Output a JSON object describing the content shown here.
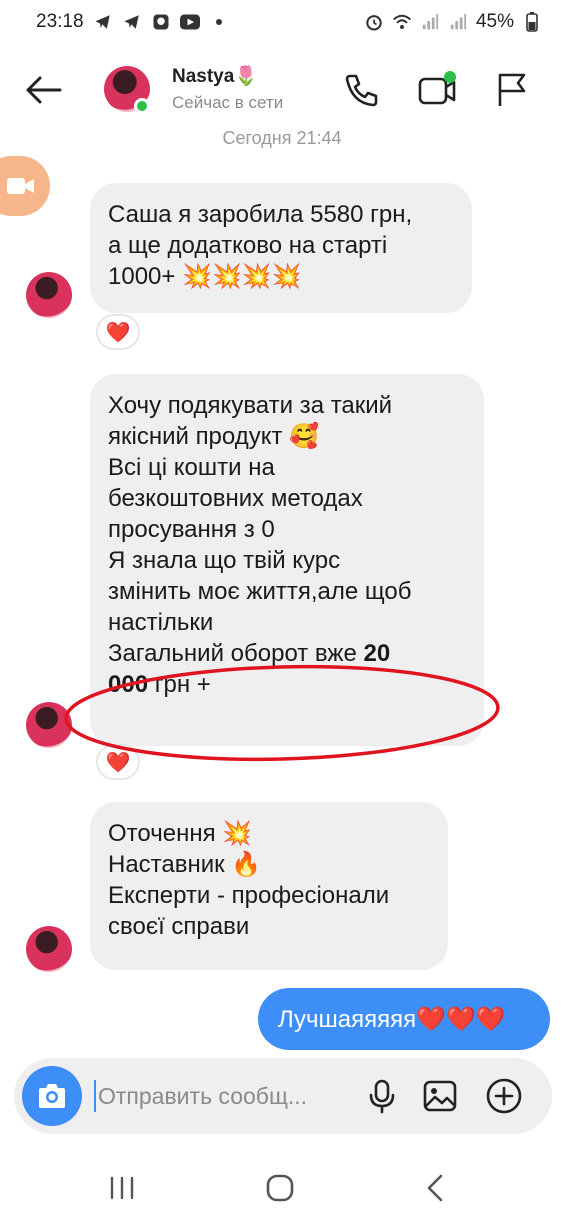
{
  "status_bar": {
    "time": "23:18",
    "battery": "45%",
    "left_icons": [
      "telegram-icon",
      "telegram-icon",
      "viber-icon",
      "youtube-icon",
      "dot-icon"
    ],
    "right_icons": [
      "alarm-icon",
      "wifi-icon",
      "signal-icon",
      "signal-icon",
      "battery-icon"
    ]
  },
  "header": {
    "contact_name": "Nastya🌷",
    "contact_status": "Сейчас в сети",
    "online_color": "#2fbe4a"
  },
  "chat": {
    "timestamp": "Сегодня 21:44",
    "messages": [
      {
        "direction": "incoming",
        "lines": [
          "Саша я заробила 5580 грн,",
          "а ще додатково на старті",
          "1000+ 💥💥💥💥"
        ],
        "reaction": "❤️"
      },
      {
        "direction": "incoming",
        "lines": [
          "Хочу подякувати за такий",
          "якісний продукт 🥰",
          "Всі ці кошти на",
          "безкоштовних методах",
          "просування з 0",
          "Я знала що твій курс",
          "змінить моє життя,але щоб",
          "настільки"
        ],
        "bold_line_prefix": "Загальний оборот вже ",
        "bold_line_value": "20",
        "bold_line2_value": "000",
        "bold_line2_suffix": " грн +",
        "reaction": "❤️"
      },
      {
        "direction": "incoming",
        "lines": [
          "Оточення 💥",
          "Наставник 🔥",
          "Експерти - професіонали",
          "своєї справи"
        ]
      },
      {
        "direction": "outgoing",
        "text": "Лучшаяяяяя❤️❤️❤️"
      }
    ]
  },
  "composer": {
    "placeholder": "Отправить сообщ..."
  },
  "colors": {
    "accent": "#3e8ef7",
    "bubble_in": "#efefef",
    "annotation": "#e0141e"
  }
}
